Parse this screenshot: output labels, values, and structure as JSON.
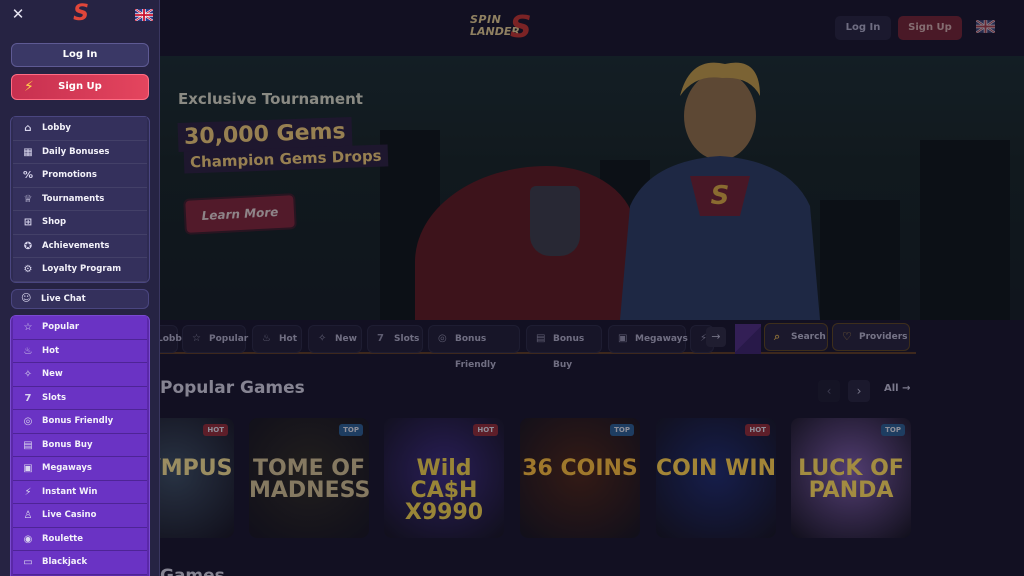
{
  "header": {
    "brand_line1": "SPIN",
    "brand_line2": "LANDER",
    "brand_mark": "S",
    "login_label": "Log In",
    "signup_label": "Sign Up",
    "language_flag": "uk-flag-icon"
  },
  "hero": {
    "subtitle": "Exclusive Tournament",
    "headline": "30,000 Gems",
    "tagline": "Champion Gems Drops",
    "cta_label": "Learn More"
  },
  "categories": [
    {
      "label": "Lobby",
      "icon": "home-icon"
    },
    {
      "label": "Popular",
      "icon": "star-icon"
    },
    {
      "label": "Hot",
      "icon": "flame-icon"
    },
    {
      "label": "New",
      "icon": "new-tag-icon"
    },
    {
      "label": "Slots",
      "icon": "slot-icon"
    },
    {
      "label": "Bonus Friendly",
      "icon": "bonus-icon"
    },
    {
      "label": "Bonus Buy",
      "icon": "bag-icon"
    },
    {
      "label": "Megaways",
      "icon": "megaways-icon"
    },
    {
      "label": "In",
      "icon": "bolt-icon"
    }
  ],
  "category_actions": {
    "search_label": "Search",
    "providers_label": "Providers"
  },
  "popular_games": {
    "title": "Popular Games",
    "all_label": "All",
    "games": [
      {
        "name": "OLYMPUS",
        "badge": "HOT",
        "bg": "#3a4a5e",
        "fg": "#e9d48a"
      },
      {
        "name": "TOME OF MADNESS",
        "badge": "TOP",
        "bg": "#2e2a22",
        "fg": "#c8b68a"
      },
      {
        "name": "Wild CA$H X9990",
        "badge": "HOT",
        "bg": "#3a2a7a",
        "fg": "#e6c84a"
      },
      {
        "name": "36 COINS",
        "badge": "TOP",
        "bg": "#4a2416",
        "fg": "#f0b43a"
      },
      {
        "name": "COIN WIN",
        "badge": "HOT",
        "bg": "#1e2a6a",
        "fg": "#f4c84a"
      },
      {
        "name": "LUCK OF PANDA",
        "badge": "TOP",
        "bg": "#7a5aa4",
        "fg": "#f4d35a"
      }
    ]
  },
  "second_section_title": "Games",
  "sidebar": {
    "close_icon": "close-icon",
    "logo": "S",
    "login_label": "Log In",
    "signup_label": "Sign Up",
    "main_items": [
      {
        "label": "Lobby",
        "icon": "home-icon"
      },
      {
        "label": "Daily Bonuses",
        "icon": "calendar-icon"
      },
      {
        "label": "Promotions",
        "icon": "percent-icon"
      },
      {
        "label": "Tournaments",
        "icon": "trophy-icon"
      },
      {
        "label": "Shop",
        "icon": "cart-icon"
      },
      {
        "label": "Achievements",
        "icon": "achievement-icon"
      },
      {
        "label": "Loyalty Program",
        "icon": "gear-icon"
      }
    ],
    "live_chat_label": "Live Chat",
    "game_items": [
      {
        "label": "Popular",
        "icon": "star-icon"
      },
      {
        "label": "Hot",
        "icon": "flame-icon"
      },
      {
        "label": "New",
        "icon": "new-tag-icon"
      },
      {
        "label": "Slots",
        "icon": "slot-icon"
      },
      {
        "label": "Bonus Friendly",
        "icon": "bonus-icon"
      },
      {
        "label": "Bonus Buy",
        "icon": "bag-icon"
      },
      {
        "label": "Megaways",
        "icon": "megaways-icon"
      },
      {
        "label": "Instant Win",
        "icon": "bolt-icon"
      },
      {
        "label": "Live Casino",
        "icon": "user-icon"
      },
      {
        "label": "Roulette",
        "icon": "roulette-icon"
      },
      {
        "label": "Blackjack",
        "icon": "cards-icon"
      }
    ]
  }
}
